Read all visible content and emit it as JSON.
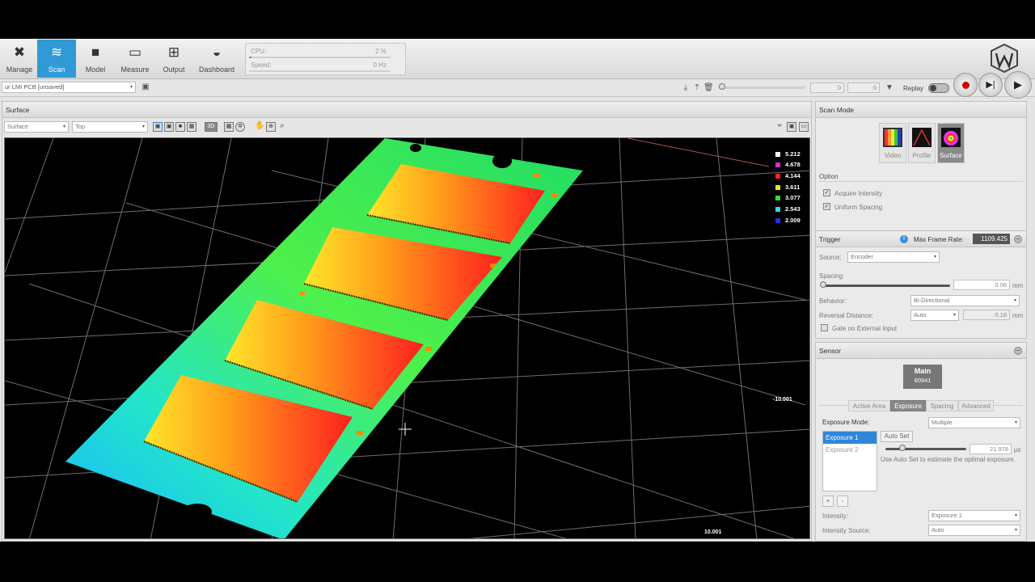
{
  "toolbar": {
    "items": [
      {
        "label": "Manage",
        "icon": "tools-icon"
      },
      {
        "label": "Scan",
        "icon": "scan-icon"
      },
      {
        "label": "Model",
        "icon": "cube-icon"
      },
      {
        "label": "Measure",
        "icon": "ruler-icon"
      },
      {
        "label": "Output",
        "icon": "network-icon"
      },
      {
        "label": "Dashboard",
        "icon": "gauge-icon"
      }
    ],
    "active": "Scan",
    "cpu_label": "CPU:",
    "cpu_value": "2 %",
    "cpu_fraction": 0.02,
    "speed_label": "Speed:",
    "speed_value": "0 Hz"
  },
  "toolbar2": {
    "job_name": "ur LMI PCB [unsaved]",
    "frame_current": "0",
    "frame_total": "0",
    "replay_label": "Replay"
  },
  "surface_panel": {
    "title": "Surface",
    "view_source": "Surface",
    "view_type": "Top",
    "mode_3d": "3D"
  },
  "viewport": {
    "legend": [
      {
        "value": "5.212",
        "color": "#ffffff"
      },
      {
        "value": "4.678",
        "color": "#cc33cc"
      },
      {
        "value": "4.144",
        "color": "#ff2222"
      },
      {
        "value": "3.611",
        "color": "#ffdd22"
      },
      {
        "value": "3.077",
        "color": "#33dd33"
      },
      {
        "value": "2.543",
        "color": "#33dddd"
      },
      {
        "value": "2.009",
        "color": "#2233dd"
      }
    ],
    "axis_y_label": "-10.001",
    "axis_x_label": "10.001"
  },
  "scan_mode": {
    "title": "Scan Mode",
    "modes": [
      "Video",
      "Profile",
      "Surface"
    ],
    "active_mode": "Surface",
    "option_title": "Option",
    "acquire_intensity": "Acquire Intensity",
    "uniform_spacing": "Uniform Spacing"
  },
  "trigger": {
    "title": "Trigger",
    "max_frame_rate_label": "Max Frame Rate:",
    "max_frame_rate": "1109.425",
    "source_label": "Source:",
    "source_value": "Encoder",
    "spacing_label": "Spacing:",
    "spacing_value": "0.06",
    "spacing_unit": "mm",
    "behavior_label": "Behavior:",
    "behavior_value": "Bi-Directional",
    "reversal_label": "Reversal Distance:",
    "reversal_mode": "Auto",
    "reversal_value": "0.18",
    "reversal_unit": "mm",
    "gate_label": "Gate on External Input"
  },
  "sensor": {
    "title": "Sensor",
    "device_name": "Main",
    "device_id": "60941",
    "tabs": [
      "Active Area",
      "Exposure",
      "Spacing",
      "Advanced"
    ],
    "active_tab": "Exposure",
    "exposure_mode_label": "Exposure Mode:",
    "exposure_mode_value": "Multiple",
    "exposures": [
      "Exposure 1",
      "Exposure 2"
    ],
    "selected_exposure": "Exposure 1",
    "auto_set_label": "Auto Set",
    "exposure_value": "21.978",
    "exposure_unit": "μs",
    "hint": "Use Auto Set to estimate the optimal exposure.",
    "add_label": "+",
    "remove_label": "-",
    "intensity_label": "Intensity:",
    "intensity_value": "Exposure 1",
    "intensity_source_label": "Intensity Source:",
    "intensity_source_value": "Auto"
  }
}
